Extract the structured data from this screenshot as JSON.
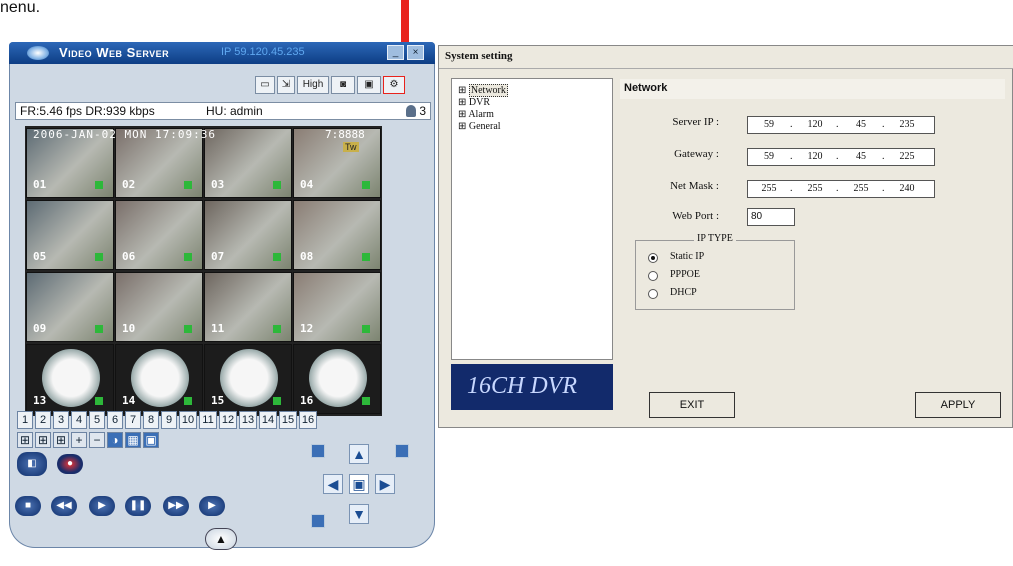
{
  "page_fragment": "nenu.",
  "app": {
    "title": "Video Web Server",
    "ip": "IP 59.120.45.235",
    "window_buttons": [
      "_",
      "×"
    ],
    "toolbar": {
      "quality": "High"
    },
    "status": {
      "fr_dr": "FR:5.46 fps DR:939 kbps",
      "hu": "HU: admin",
      "users": "3"
    },
    "overlay": {
      "date": "2006-JAN-02 MON 17:09:36",
      "time": "7:8888",
      "flag": "Tw"
    },
    "cameras": [
      "01",
      "02",
      "03",
      "04",
      "05",
      "06",
      "07",
      "08",
      "09",
      "10",
      "11",
      "12",
      "13",
      "14",
      "15",
      "16"
    ],
    "channel_buttons": [
      "1",
      "2",
      "3",
      "4",
      "5",
      "6",
      "7",
      "8",
      "9",
      "10",
      "11",
      "12",
      "13",
      "14",
      "15",
      "16"
    ]
  },
  "dialog": {
    "title": "System setting",
    "tree": [
      "Network",
      "DVR",
      "Alarm",
      "General"
    ],
    "brand": "16CH DVR",
    "section_title": "Network",
    "fields": {
      "server_ip": {
        "label": "Server IP :",
        "parts": [
          "59",
          "120",
          "45",
          "235"
        ]
      },
      "gateway": {
        "label": "Gateway :",
        "parts": [
          "59",
          "120",
          "45",
          "225"
        ]
      },
      "netmask": {
        "label": "Net Mask :",
        "parts": [
          "255",
          "255",
          "255",
          "240"
        ]
      },
      "web_port": {
        "label": "Web Port :",
        "value": "80"
      }
    },
    "ip_type": {
      "legend": "IP TYPE",
      "options": [
        "Static IP",
        "PPPOE",
        "DHCP"
      ],
      "selected": "Static IP"
    },
    "exit_label": "EXIT",
    "apply_label": "APPLY"
  },
  "colors": {
    "arrow": "#e8231d",
    "brand_bg": "#122a6b",
    "title_blue": "#0d3d84"
  }
}
